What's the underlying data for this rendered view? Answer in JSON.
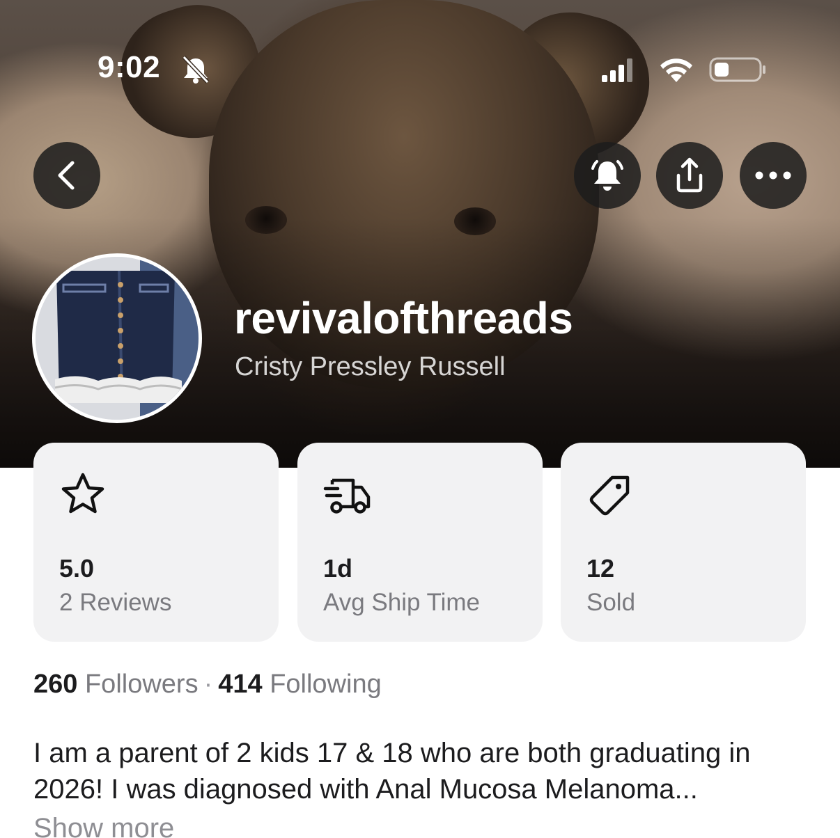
{
  "status_bar": {
    "time": "9:02",
    "icons": [
      "bell-slash-icon",
      "cellular-signal-icon",
      "wifi-icon",
      "battery-icon"
    ]
  },
  "header": {
    "buttons": [
      "back-icon",
      "notification-bell-icon",
      "share-icon",
      "more-options-icon"
    ]
  },
  "profile": {
    "username": "revivalofthreads",
    "full_name": "Cristy Pressley Russell"
  },
  "stats": [
    {
      "icon": "star-icon",
      "value": "5.0",
      "label": "2 Reviews"
    },
    {
      "icon": "delivery-truck-icon",
      "value": "1d",
      "label": "Avg Ship Time"
    },
    {
      "icon": "price-tag-icon",
      "value": "12",
      "label": "Sold"
    }
  ],
  "social": {
    "followers_count": "260",
    "followers_label": "Followers",
    "separator": "·",
    "following_count": "414",
    "following_label": "Following"
  },
  "bio": {
    "text": "I am a parent of 2 kids 17 & 18 who are both graduating in 2026! I was diagnosed with Anal Mucosa Melanoma...",
    "show_more_label": "Show more"
  },
  "colors": {
    "card_background": "#f2f2f3",
    "secondary_text": "#7a7a7f",
    "primary_text": "#1c1c1e",
    "overlay_button": "#1c1c1c"
  }
}
